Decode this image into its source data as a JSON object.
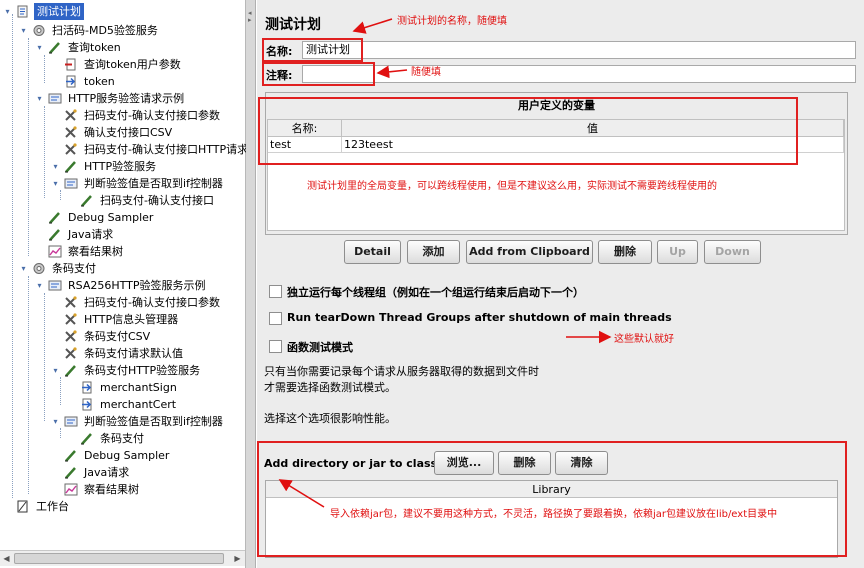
{
  "tree": {
    "items": [
      {
        "label": "测试计划",
        "icon": "test-plan-icon",
        "selected": true
      },
      {
        "label": "扫活码-MD5验签服务",
        "icon": "thread-group-icon"
      },
      {
        "label": "查询token",
        "icon": "sampler-icon"
      },
      {
        "label": "查询token用户参数",
        "icon": "preprocessor-icon"
      },
      {
        "label": "token",
        "icon": "extractor-icon"
      },
      {
        "label": "HTTP服务验签请求示例",
        "icon": "controller-icon"
      },
      {
        "label": "扫码支付-确认支付接口参数",
        "icon": "config-icon"
      },
      {
        "label": "确认支付接口CSV",
        "icon": "config-icon"
      },
      {
        "label": "扫码支付-确认支付接口HTTP请求",
        "icon": "config-icon"
      },
      {
        "label": "HTTP验签服务",
        "icon": "sampler-icon"
      },
      {
        "label": "判断验签值是否取到if控制器",
        "icon": "controller-icon"
      },
      {
        "label": "扫码支付-确认支付接口",
        "icon": "sampler-icon"
      },
      {
        "label": "Debug Sampler",
        "icon": "sampler-icon"
      },
      {
        "label": "Java请求",
        "icon": "sampler-icon"
      },
      {
        "label": "察看结果树",
        "icon": "listener-icon"
      },
      {
        "label": "条码支付",
        "icon": "thread-group-icon"
      },
      {
        "label": "RSA256HTTP验签服务示例",
        "icon": "controller-icon"
      },
      {
        "label": "扫码支付-确认支付接口参数",
        "icon": "config-icon"
      },
      {
        "label": "HTTP信息头管理器",
        "icon": "config-icon"
      },
      {
        "label": "条码支付CSV",
        "icon": "config-icon"
      },
      {
        "label": "条码支付请求默认值",
        "icon": "config-icon"
      },
      {
        "label": "条码支付HTTP验签服务",
        "icon": "sampler-icon"
      },
      {
        "label": "merchantSign",
        "icon": "extractor-icon"
      },
      {
        "label": "merchantCert",
        "icon": "extractor-icon"
      },
      {
        "label": "判断验签值是否取到if控制器",
        "icon": "controller-icon"
      },
      {
        "label": "条码支付",
        "icon": "sampler-icon"
      },
      {
        "label": "Debug Sampler",
        "icon": "sampler-icon"
      },
      {
        "label": "Java请求",
        "icon": "sampler-icon"
      },
      {
        "label": "察看结果树",
        "icon": "listener-icon"
      },
      {
        "label": "工作台",
        "icon": "workbench-icon"
      }
    ]
  },
  "panel": {
    "title": "测试计划",
    "name_label": "名称:",
    "name_value": "测试计划",
    "comment_label": "注释:",
    "comment_value": "",
    "vars_title": "用户定义的变量",
    "vars_columns": [
      "名称:",
      "值"
    ],
    "vars_rows": [
      [
        "test",
        "123teest"
      ]
    ],
    "buttons": {
      "detail": "Detail",
      "add": "添加",
      "add_clipboard": "Add from Clipboard",
      "delete": "删除",
      "up": "Up",
      "down": "Down"
    },
    "options": {
      "serialize": "独立运行每个线程组（例如在一个组运行结束后启动下一个）",
      "teardown": "Run tearDown Thread Groups after shutdown of main threads",
      "functional": "函数测试模式"
    },
    "functional_note_1": "只有当你需要记录每个请求从服务器取得的数据到文件时",
    "functional_note_2": "才需要选择函数测试模式。",
    "perf_note": "选择这个选项很影响性能。",
    "classpath_label": "Add directory or jar to classpath",
    "classpath_buttons": {
      "browse": "浏览...",
      "delete": "删除",
      "clear": "清除"
    },
    "library_header": "Library"
  },
  "annotations": {
    "name": "测试计划的名称，随便填",
    "comment": "随便填",
    "vars": "测试计划里的全局变量，可以跨线程使用，但是不建议这么用，实际测试不需要跨线程使用的",
    "defaults": "这些默认就好",
    "classpath": "导入依赖jar包，建议不要用这种方式，不灵活，路径换了要跟着换，依赖jar包建议放在lib/ext目录中"
  },
  "colors": {
    "annotation": "#e01010",
    "selection": "#2f64c6"
  }
}
